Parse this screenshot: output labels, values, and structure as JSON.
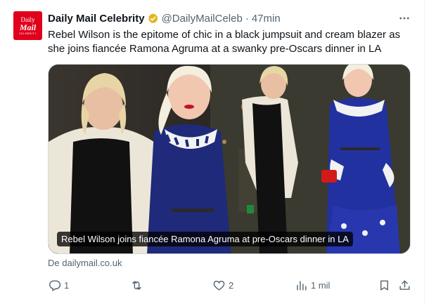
{
  "author": {
    "avatar_line1": "Daily",
    "avatar_line2": "Mail",
    "avatar_line3": "CELEBRITY",
    "name": "Daily Mail Celebrity",
    "handle": "@DailyMailCeleb",
    "separator": "·",
    "time": "47min"
  },
  "tweet": {
    "text": "Rebel Wilson is the epitome of chic in a black jumpsuit and cream blazer as she joins fiancée Ramona Agruma at a swanky pre-Oscars dinner in LA"
  },
  "media": {
    "caption": "Rebel Wilson joins fiancée Ramona Agruma at pre-Oscars dinner in LA"
  },
  "link": {
    "source": "De dailymail.co.uk"
  },
  "actions": {
    "replies": "1",
    "likes": "2",
    "views": "1 mil"
  },
  "icons": [
    "verified-badge-icon",
    "more-icon",
    "reply-icon",
    "retweet-icon",
    "like-icon",
    "views-icon",
    "bookmark-icon",
    "share-icon"
  ],
  "colors": {
    "brand": "#e0001b",
    "verified": "#e2b719",
    "muted": "#536471",
    "text": "#0f1419"
  }
}
